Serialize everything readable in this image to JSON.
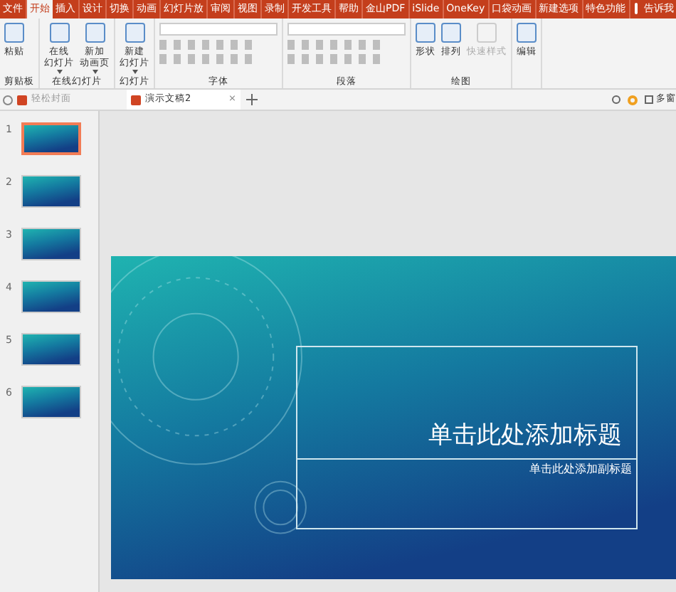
{
  "menu_tabs": [
    {
      "label": "文件",
      "selected": false
    },
    {
      "label": "开始",
      "selected": true
    },
    {
      "label": "插入",
      "selected": false
    },
    {
      "label": "设计",
      "selected": false
    },
    {
      "label": "切换",
      "selected": false
    },
    {
      "label": "动画",
      "selected": false
    },
    {
      "label": "幻灯片放",
      "selected": false
    },
    {
      "label": "审阅",
      "selected": false
    },
    {
      "label": "视图",
      "selected": false
    },
    {
      "label": "录制",
      "selected": false
    },
    {
      "label": "开发工具",
      "selected": false
    },
    {
      "label": "帮助",
      "selected": false
    },
    {
      "label": "金山PDF",
      "selected": false
    },
    {
      "label": "iSlide",
      "selected": false
    },
    {
      "label": "OneKey",
      "selected": false
    },
    {
      "label": "口袋动画",
      "selected": false
    },
    {
      "label": "新建选项",
      "selected": false
    },
    {
      "label": "特色功能",
      "selected": false
    }
  ],
  "tell_me": "告诉我",
  "ribbon_groups": [
    {
      "label": "剪贴板",
      "buttons": [
        {
          "label": "粘贴",
          "disabled": false
        }
      ]
    },
    {
      "label": "在线幻灯片",
      "buttons": [
        {
          "label": "在线幻灯片",
          "disabled": false
        },
        {
          "label": "新加动画页",
          "disabled": false
        }
      ]
    },
    {
      "label": "幻灯片",
      "buttons": [
        {
          "label": "新建幻灯片",
          "disabled": false
        }
      ]
    },
    {
      "label": "字体"
    },
    {
      "label": "段落"
    },
    {
      "label": "绘图",
      "buttons": [
        {
          "label": "形状",
          "disabled": false
        },
        {
          "label": "排列",
          "disabled": false
        },
        {
          "label": "快速样式",
          "disabled": true
        }
      ]
    },
    {
      "buttons": [
        {
          "label": "编辑",
          "disabled": false
        }
      ]
    }
  ],
  "doc_tabs": [
    {
      "label": "轻松封面",
      "selected": false
    },
    {
      "label": "演示文稿2",
      "selected": true,
      "close": "×"
    }
  ],
  "multi_window": "多窗",
  "slides": [
    {
      "number": "1",
      "selected": true
    },
    {
      "number": "2",
      "selected": false
    },
    {
      "number": "3",
      "selected": false
    },
    {
      "number": "4",
      "selected": false
    },
    {
      "number": "5",
      "selected": false
    },
    {
      "number": "6",
      "selected": false
    }
  ],
  "slide": {
    "title": "单击此处添加标题",
    "subtitle": "单击此处添加副标题"
  }
}
